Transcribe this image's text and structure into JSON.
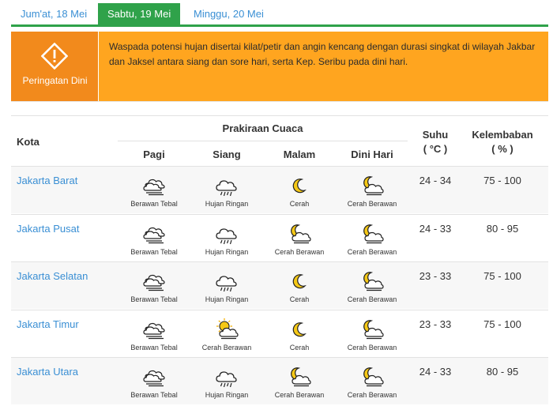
{
  "tabs": [
    {
      "label": "Jum'at, 18 Mei"
    },
    {
      "label": "Sabtu, 19 Mei"
    },
    {
      "label": "Minggu, 20 Mei"
    }
  ],
  "warning": {
    "label": "Peringatan Dini",
    "text": "Waspada potensi hujan disertai kilat/petir dan angin kencang dengan durasi singkat di wilayah Jakbar dan Jaksel antara siang dan sore hari, serta Kep. Seribu pada dini hari."
  },
  "table": {
    "col_city": "Kota",
    "col_forecast": "Prakiraan Cuaca",
    "periods": [
      "Pagi",
      "Siang",
      "Malam",
      "Dini Hari"
    ],
    "col_temp": "Suhu",
    "col_temp_unit": "( °C )",
    "col_humidity": "Kelembaban",
    "col_humidity_unit": "( % )",
    "rows": [
      {
        "city": "Jakarta Barat",
        "temp": "24 - 34",
        "humidity": "75 - 100",
        "forecast": [
          {
            "icon": "cloudy-heavy-icon",
            "label": "Berawan Tebal"
          },
          {
            "icon": "light-rain-icon",
            "label": "Hujan Ringan"
          },
          {
            "icon": "clear-night-icon",
            "label": "Cerah"
          },
          {
            "icon": "partly-cloudy-night-icon",
            "label": "Cerah Berawan"
          }
        ]
      },
      {
        "city": "Jakarta Pusat",
        "temp": "24 - 33",
        "humidity": "80 - 95",
        "forecast": [
          {
            "icon": "cloudy-heavy-icon",
            "label": "Berawan Tebal"
          },
          {
            "icon": "light-rain-icon",
            "label": "Hujan Ringan"
          },
          {
            "icon": "partly-cloudy-night-icon",
            "label": "Cerah Berawan"
          },
          {
            "icon": "partly-cloudy-night-icon",
            "label": "Cerah Berawan"
          }
        ]
      },
      {
        "city": "Jakarta Selatan",
        "temp": "23 - 33",
        "humidity": "75 - 100",
        "forecast": [
          {
            "icon": "cloudy-heavy-icon",
            "label": "Berawan Tebal"
          },
          {
            "icon": "light-rain-icon",
            "label": "Hujan Ringan"
          },
          {
            "icon": "clear-night-icon",
            "label": "Cerah"
          },
          {
            "icon": "partly-cloudy-night-icon",
            "label": "Cerah Berawan"
          }
        ]
      },
      {
        "city": "Jakarta Timur",
        "temp": "23 - 33",
        "humidity": "75 - 100",
        "forecast": [
          {
            "icon": "cloudy-heavy-icon",
            "label": "Berawan Tebal"
          },
          {
            "icon": "partly-cloudy-day-icon",
            "label": "Cerah Berawan"
          },
          {
            "icon": "clear-night-icon",
            "label": "Cerah"
          },
          {
            "icon": "partly-cloudy-night-icon",
            "label": "Cerah Berawan"
          }
        ]
      },
      {
        "city": "Jakarta Utara",
        "temp": "24 - 33",
        "humidity": "80 - 95",
        "forecast": [
          {
            "icon": "cloudy-heavy-icon",
            "label": "Berawan Tebal"
          },
          {
            "icon": "light-rain-icon",
            "label": "Hujan Ringan"
          },
          {
            "icon": "partly-cloudy-night-icon",
            "label": "Cerah Berawan"
          },
          {
            "icon": "partly-cloudy-night-icon",
            "label": "Cerah Berawan"
          }
        ]
      }
    ]
  },
  "colors": {
    "tab_active": "#2fa24a",
    "warning_bg": "#ffa51f",
    "warning_left": "#f28a1c",
    "link": "#3a8fd4"
  }
}
